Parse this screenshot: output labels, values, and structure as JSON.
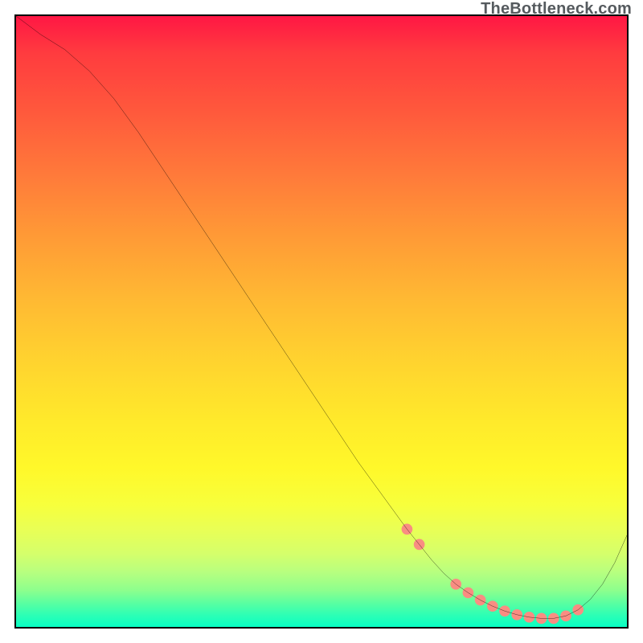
{
  "attribution": "TheBottleneck.com",
  "chart_data": {
    "type": "line",
    "title": "",
    "xlabel": "",
    "ylabel": "",
    "xlim": [
      0,
      100
    ],
    "ylim": [
      0,
      100
    ],
    "grid": false,
    "legend": false,
    "gradient_colors_top_to_bottom": [
      "#ff1744",
      "#ffb833",
      "#fff82a",
      "#08ffc4"
    ],
    "series": [
      {
        "name": "curve",
        "color": "#000000",
        "x": [
          0,
          4,
          8,
          12,
          16,
          20,
          24,
          28,
          32,
          36,
          40,
          44,
          48,
          52,
          56,
          60,
          64,
          66,
          68,
          70,
          72,
          74,
          76,
          78,
          80,
          82,
          84,
          86,
          88,
          90,
          92,
          94,
          96,
          98,
          100
        ],
        "y": [
          100,
          97,
          94.5,
          91,
          86.5,
          81,
          75,
          69,
          63,
          57,
          51,
          45,
          39,
          33,
          27,
          21.5,
          16,
          13.5,
          11,
          8.8,
          7,
          5.6,
          4.4,
          3.4,
          2.6,
          2,
          1.6,
          1.4,
          1.4,
          1.8,
          2.8,
          4.5,
          7,
          10.5,
          15
        ]
      },
      {
        "name": "dots",
        "color": "#f98d82",
        "type": "scatter",
        "x": [
          64,
          66,
          72,
          74,
          76,
          78,
          80,
          82,
          84,
          86,
          88,
          90,
          92
        ],
        "y": [
          16,
          13.5,
          7,
          5.6,
          4.4,
          3.4,
          2.6,
          2,
          1.6,
          1.4,
          1.4,
          1.8,
          2.8
        ]
      }
    ]
  }
}
